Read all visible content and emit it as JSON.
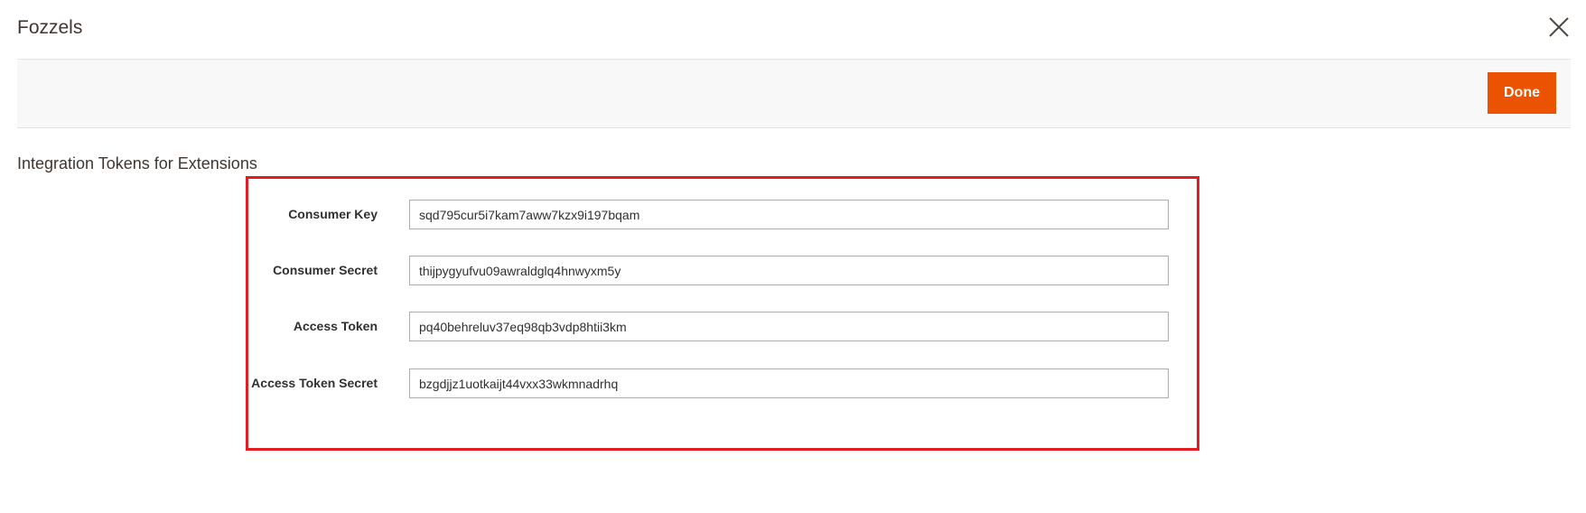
{
  "modal": {
    "title": "Fozzels"
  },
  "icons": {
    "close": "close-icon"
  },
  "toolbar": {
    "done_label": "Done"
  },
  "section": {
    "title": "Integration Tokens for Extensions"
  },
  "fields": [
    {
      "label": "Consumer Key",
      "value": "sqd795cur5i7kam7aww7kzx9i197bqam"
    },
    {
      "label": "Consumer Secret",
      "value": "thijpygyufvu09awraldglq4hnwyxm5y"
    },
    {
      "label": "Access Token",
      "value": "pq40behreluv37eq98qb3vdp8htii3km"
    },
    {
      "label": "Access Token Secret",
      "value": "bzgdjjz1uotkaijt44vxx33wkmnadrhq"
    }
  ],
  "colors": {
    "accent": "#eb5202",
    "highlight_border": "#e31b23",
    "toolbar_bg": "#f8f8f8"
  }
}
